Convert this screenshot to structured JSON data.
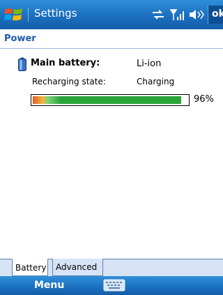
{
  "titlebar": {
    "title": "Settings",
    "ok_label": "ok",
    "icons": [
      "windows-start-icon",
      "connectivity-icon",
      "signal-icon",
      "volume-icon"
    ]
  },
  "page": {
    "heading": "Power"
  },
  "battery": {
    "main_label": "Main battery:",
    "main_value": "Li-ion",
    "recharge_label": "Recharging state:",
    "recharge_value": "Charging",
    "level_percent": 96,
    "level_text": "96%"
  },
  "tabs": [
    {
      "label": "Battery",
      "active": true
    },
    {
      "label": "Advanced",
      "active": false
    }
  ],
  "menubar": {
    "menu_label": "Menu",
    "keyboard_icon": "keyboard-icon"
  },
  "colors": {
    "accent": "#1b6fbf",
    "heading": "#1e5aa8",
    "battery_fill": "#2ba43a"
  }
}
